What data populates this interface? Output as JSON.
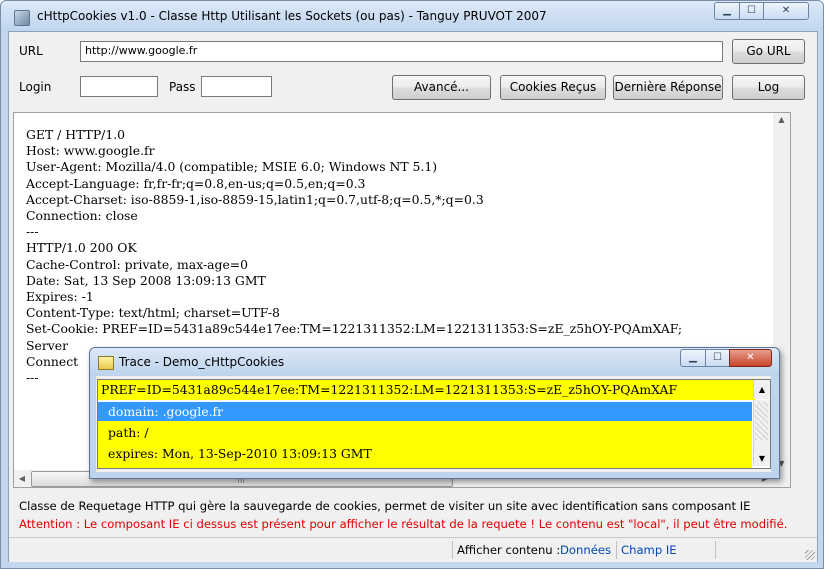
{
  "window": {
    "title": "cHttpCookies v1.0 - Classe Http Utilisant les Sockets (ou pas) - Tanguy PRUVOT 2007",
    "controls": {
      "minimize": "▁",
      "maximize": "☐",
      "close": "✕"
    }
  },
  "toolbar": {
    "url_label": "URL",
    "url_value": "http://www.google.fr",
    "go_label": "Go URL",
    "login_label": "Login",
    "login_value": "",
    "pass_label": "Pass",
    "pass_value": "",
    "advanced_label": "Avancé...",
    "cookies_label": "Cookies Reçus",
    "last_response_label": "Dernière Réponse",
    "log_label": "Log"
  },
  "content": {
    "lines": [
      "GET / HTTP/1.0",
      "Host: www.google.fr",
      "User-Agent: Mozilla/4.0 (compatible; MSIE 6.0; Windows NT 5.1)",
      "Accept-Language: fr,fr-fr;q=0.8,en-us;q=0.5,en;q=0.3",
      "Accept-Charset: iso-8859-1,iso-8859-15,latin1;q=0.7,utf-8;q=0.5,*;q=0.3",
      "Connection: close",
      "---",
      "HTTP/1.0 200 OK",
      "Cache-Control: private, max-age=0",
      "Date: Sat, 13 Sep 2008 13:09:13 GMT",
      "Expires: -1",
      "Content-Type: text/html; charset=UTF-8",
      "Set-Cookie: PREF=ID=5431a89c544e17ee:TM=1221311352:LM=1221311353:S=zE_z5hOY-PQAmXAF;",
      "Server",
      "Connect",
      "---"
    ]
  },
  "description": {
    "line1": "Classe de Requetage HTTP qui gère la sauvegarde de cookies, permet de visiter un site avec identification sans composant IE",
    "line2": "Attention : Le composant IE ci dessus est présent pour afficher le résultat de la requete ! Le contenu est \"local\", il peut être modifié.",
    "warning_color": "#e00000"
  },
  "statusbar": {
    "show_label": "Afficher contenu :",
    "link_data": "Données",
    "link_ie": "Champ IE"
  },
  "trace": {
    "title": "Trace - Demo_cHttpCookies",
    "header": "PREF=ID=5431a89c544e17ee:TM=1221311352:LM=1221311353:S=zE_z5hOY-PQAmXAF",
    "rows": [
      "domain: .google.fr",
      "path: /",
      "expires: Mon, 13-Sep-2010 13:09:13 GMT"
    ],
    "highlight_color": "#ffff00",
    "selection_color": "#3399ff"
  }
}
